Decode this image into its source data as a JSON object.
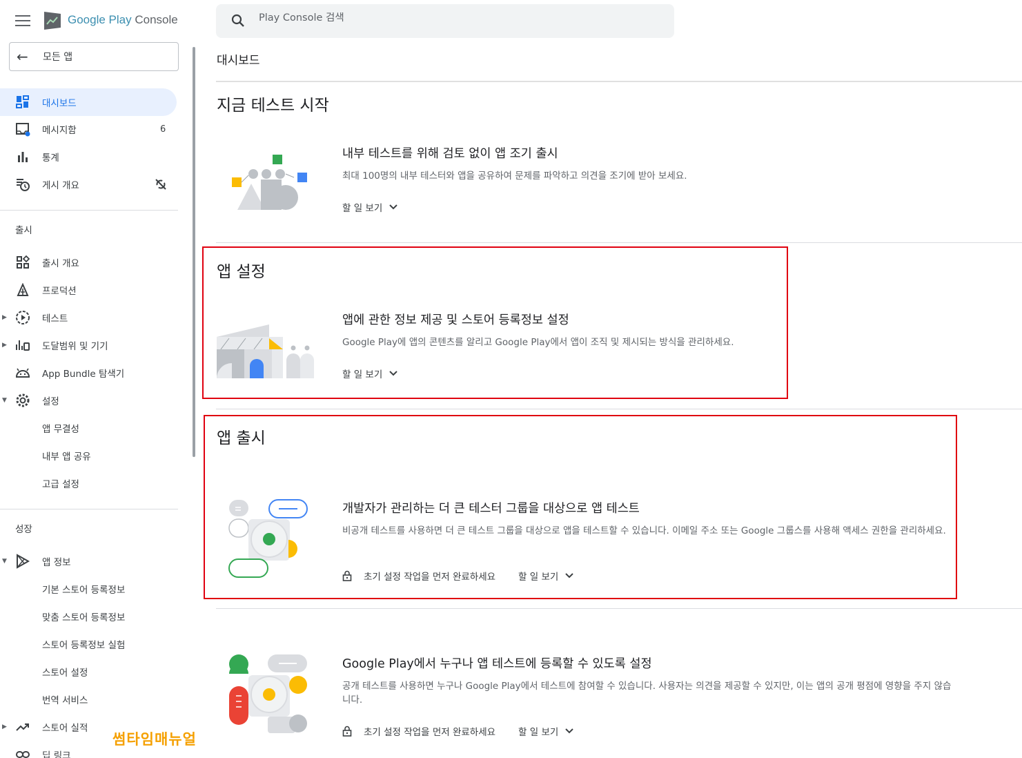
{
  "app": {
    "logo_google_play": "Google Play",
    "logo_console": " Console"
  },
  "sidebar": {
    "back_label": "모든 앱",
    "items": [
      {
        "label": "대시보드",
        "icon": "dashboard-icon",
        "active": true
      },
      {
        "label": "메시지함",
        "icon": "inbox-icon",
        "count": "6"
      },
      {
        "label": "통계",
        "icon": "bar-chart-icon"
      },
      {
        "label": "게시 개요",
        "icon": "publishing-overview-icon",
        "trailing_icon": "sync-off-icon"
      }
    ],
    "release_section": "출시",
    "release_items": [
      {
        "label": "출시 개요",
        "icon": "release-overview-icon"
      },
      {
        "label": "프로덕션",
        "icon": "production-icon"
      },
      {
        "label": "테스트",
        "icon": "testing-icon"
      },
      {
        "label": "도달범위 및 기기",
        "icon": "reach-devices-icon"
      },
      {
        "label": "App Bundle 탐색기",
        "icon": "android-icon"
      },
      {
        "label": "설정",
        "icon": "gear-icon"
      },
      {
        "label": "앱 무결성"
      },
      {
        "label": "내부 앱 공유"
      },
      {
        "label": "고급 설정"
      }
    ],
    "grow_section": "성장",
    "grow_items": [
      {
        "label": "앱 정보",
        "icon": "play-store-icon"
      },
      {
        "label": "기본 스토어 등록정보"
      },
      {
        "label": "맞춤 스토어 등록정보"
      },
      {
        "label": "스토어 등록정보 실험"
      },
      {
        "label": "스토어 설정"
      },
      {
        "label": "번역 서비스"
      },
      {
        "label": "스토어 실적",
        "icon": "trending-up-icon"
      },
      {
        "label": "딥 링크",
        "icon": "link-icon"
      }
    ]
  },
  "search": {
    "placeholder": "Play Console 검색"
  },
  "breadcrumb": "대시보드",
  "sections": {
    "start_testing": {
      "title": "지금 테스트 시작",
      "task": {
        "title": "내부 테스트를 위해 검토 없이 앱 조기 출시",
        "desc": "최대 100명의 내부 테스터와 앱을 공유하여 문제를 파악하고 의견을 조기에 받아 보세요.",
        "link": "할 일 보기"
      }
    },
    "app_setup": {
      "title": "앱 설정",
      "task": {
        "title": "앱에 관한 정보 제공 및 스토어 등록정보 설정",
        "desc": "Google Play에 앱의 콘텐츠를 알리고 Google Play에서 앱이 조직 및 제시되는 방식을 관리하세요.",
        "link": "할 일 보기"
      }
    },
    "app_release": {
      "title": "앱 출시",
      "task1": {
        "title": "개발자가 관리하는 더 큰 테스터 그룹을 대상으로 앱 테스트",
        "desc": "비공개 테스트를 사용하면 더 큰 테스트 그룹을 대상으로 앱을 테스트할 수 있습니다. 이메일 주소 또는 Google 그룹스를 사용해 액세스 권한을 관리하세요.",
        "locked": "초기 설정 작업을 먼저 완료하세요",
        "link": "할 일 보기"
      },
      "task2": {
        "title": "Google Play에서 누구나 앱 테스트에 등록할 수 있도록 설정",
        "desc": "공개 테스트를 사용하면 누구나 Google Play에서 테스트에 참여할 수 있습니다. 사용자는 의견을 제공할 수 있지만, 이는 앱의 공개 평점에 영향을 주지 않습니다.",
        "locked": "초기 설정 작업을 먼저 완료하세요",
        "link": "할 일 보기"
      }
    }
  },
  "watermark": "썸타임매뉴얼",
  "colors": {
    "accent": "#1a73e8",
    "highlight_box": "#e0000f",
    "active_bg": "#e8f0fe",
    "green": "#34a853",
    "yellow": "#fbbc04",
    "red": "#ea4335"
  }
}
